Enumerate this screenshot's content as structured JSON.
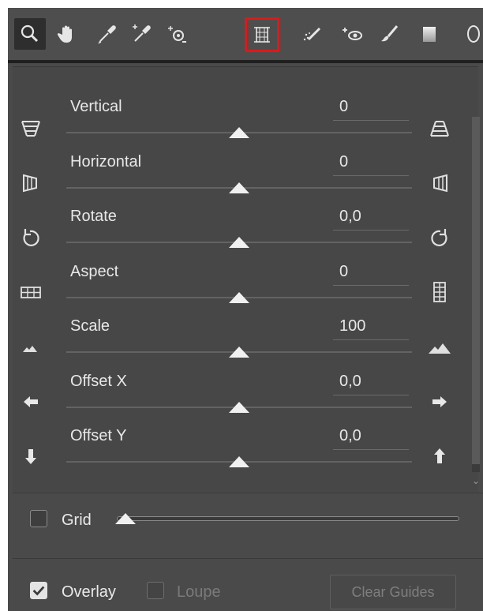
{
  "toolbar": {
    "tools": [
      {
        "name": "zoom-tool",
        "icon": "magnifier-icon",
        "active": true
      },
      {
        "name": "hand-tool",
        "icon": "hand-icon"
      },
      {
        "name": "white-balance-tool",
        "icon": "eyedropper-icon"
      },
      {
        "name": "color-sampler-tool",
        "icon": "color-sampler-icon"
      },
      {
        "name": "target-adjustment-tool",
        "icon": "target-adjust-icon"
      },
      {
        "name": "transform-tool",
        "icon": "transform-icon",
        "selected": true
      },
      {
        "name": "spot-removal-tool",
        "icon": "spot-removal-icon"
      },
      {
        "name": "red-eye-tool",
        "icon": "red-eye-icon"
      },
      {
        "name": "adjustment-brush-tool",
        "icon": "brush-icon"
      },
      {
        "name": "graduated-filter-tool",
        "icon": "graduated-filter-icon"
      },
      {
        "name": "radial-filter-tool",
        "icon": "radial-filter-icon"
      }
    ]
  },
  "sliders": [
    {
      "label": "Vertical",
      "value": "0",
      "left_icon": "vertical-left-icon",
      "right_icon": "vertical-right-icon",
      "position": 0.5
    },
    {
      "label": "Horizontal",
      "value": "0",
      "left_icon": "horizontal-left-icon",
      "right_icon": "horizontal-right-icon",
      "position": 0.5
    },
    {
      "label": "Rotate",
      "value": "0,0",
      "left_icon": "rotate-ccw-icon",
      "right_icon": "rotate-cw-icon",
      "position": 0.5
    },
    {
      "label": "Aspect",
      "value": "0",
      "left_icon": "aspect-wide-icon",
      "right_icon": "aspect-tall-icon",
      "position": 0.5
    },
    {
      "label": "Scale",
      "value": "100",
      "left_icon": "scale-small-icon",
      "right_icon": "scale-large-icon",
      "position": 0.5
    },
    {
      "label": "Offset X",
      "value": "0,0",
      "left_icon": "arrow-left-icon",
      "right_icon": "arrow-right-icon",
      "position": 0.5
    },
    {
      "label": "Offset Y",
      "value": "0,0",
      "left_icon": "arrow-down-icon",
      "right_icon": "arrow-up-icon",
      "position": 0.5
    }
  ],
  "grid": {
    "label": "Grid",
    "checked": false,
    "slider_position": 0.0
  },
  "bottom": {
    "overlay_label": "Overlay",
    "overlay_checked": true,
    "loupe_label": "Loupe",
    "loupe_checked": false,
    "clear_guides_label": "Clear Guides"
  },
  "colors": {
    "accent_selected": "#e01818",
    "panel_bg": "#474747",
    "text": "#e8e8e8"
  }
}
